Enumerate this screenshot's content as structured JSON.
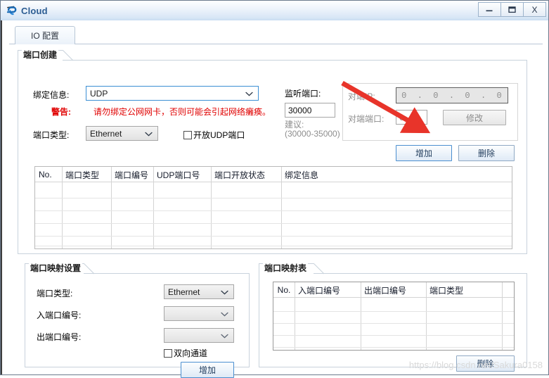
{
  "window": {
    "title": "Cloud",
    "icon": "cloud-icon",
    "buttons": {
      "minimize": "minimize-icon",
      "maximize": "maximize-icon",
      "close": "X"
    }
  },
  "tabs": [
    {
      "label": "IO 配置",
      "active": true
    }
  ],
  "port_create": {
    "title": "端口创建",
    "binding_label": "绑定信息:",
    "binding_value": "UDP",
    "warning_label": "警告:",
    "warning_text": "请勿绑定公网网卡，否则可能会引起网络癱痪。",
    "port_type_label": "端口类型:",
    "port_type_value": "Ethernet",
    "open_udp_checkbox_label": "开放UDP端口",
    "open_udp_checked": false,
    "listen_port_label": "监听端口:",
    "listen_port_value": "30000",
    "suggest_label": "建议:",
    "suggest_range": "(30000-35000)",
    "peer_ip_label": "对端IP:",
    "peer_ip_octets": [
      "0",
      "0",
      "0",
      "0"
    ],
    "peer_port_label": "对端端口:",
    "peer_port_value": "0",
    "modify_button": "修改",
    "add_button": "增加",
    "delete_button": "删除"
  },
  "port_table": {
    "columns": [
      "No.",
      "端口类型",
      "端口编号",
      "UDP端口号",
      "端口开放状态",
      "绑定信息"
    ],
    "rows": []
  },
  "mapping_settings": {
    "title": "端口映射设置",
    "port_type_label": "端口类型:",
    "port_type_value": "Ethernet",
    "in_port_label": "入端口编号:",
    "in_port_value": "",
    "out_port_label": "出端口编号:",
    "out_port_value": "",
    "bidirectional_label": "双向通道",
    "bidirectional_checked": false,
    "add_button": "增加"
  },
  "mapping_table": {
    "title": "端口映射表",
    "columns": [
      "No.",
      "入端口编号",
      "出端口编号",
      "端口类型"
    ],
    "rows": [],
    "delete_button": "删除"
  },
  "watermark": "https://blog.csdn.net/Sakura0158",
  "colors": {
    "titlebar_text": "#2b5c92",
    "warning": "#e00000",
    "arrow": "#e8342a",
    "button_text": "#1f3b5c",
    "disabled_text": "#8d8d8d"
  }
}
